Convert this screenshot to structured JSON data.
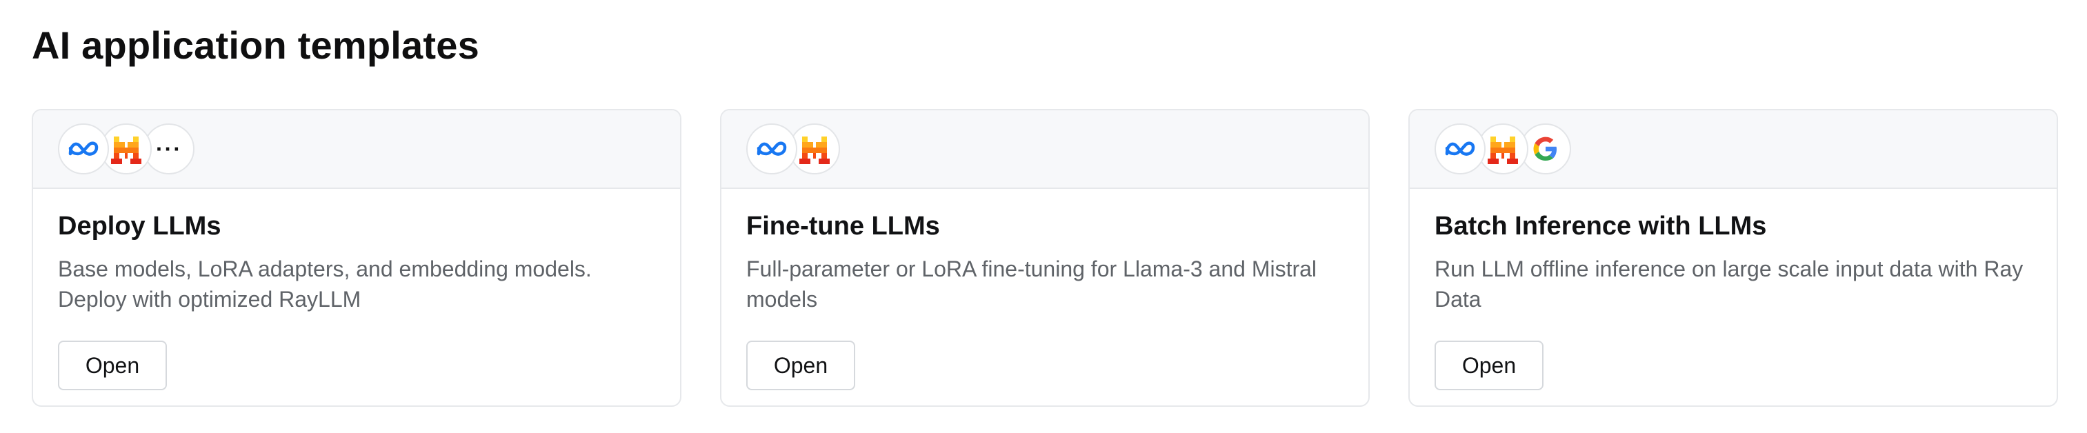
{
  "page": {
    "title": "AI application templates"
  },
  "cards": [
    {
      "title": "Deploy LLMs",
      "description": "Base models, LoRA adapters, and embedding models. Deploy with optimized RayLLM",
      "button": "Open",
      "logos": [
        "meta-icon",
        "mistral-icon",
        "more-icon"
      ],
      "more_glyph": "···"
    },
    {
      "title": "Fine-tune LLMs",
      "description": "Full-parameter or LoRA fine-tuning for Llama-3 and Mistral models",
      "button": "Open",
      "logos": [
        "meta-icon",
        "mistral-icon"
      ]
    },
    {
      "title": "Batch Inference with LLMs",
      "description": "Run LLM offline inference on large scale input data with Ray Data",
      "button": "Open",
      "logos": [
        "meta-icon",
        "mistral-icon",
        "google-icon"
      ],
      "google_letter": "G"
    }
  ],
  "colors": {
    "meta_blue": "#1877f2",
    "mistral_red": "#e4291a",
    "mistral_orange": "#fa7a12",
    "mistral_yellow": "#ffd12a",
    "google_blue": "#4285f4",
    "google_red": "#ea4335",
    "google_yellow": "#fbbc05",
    "google_green": "#34a853"
  }
}
